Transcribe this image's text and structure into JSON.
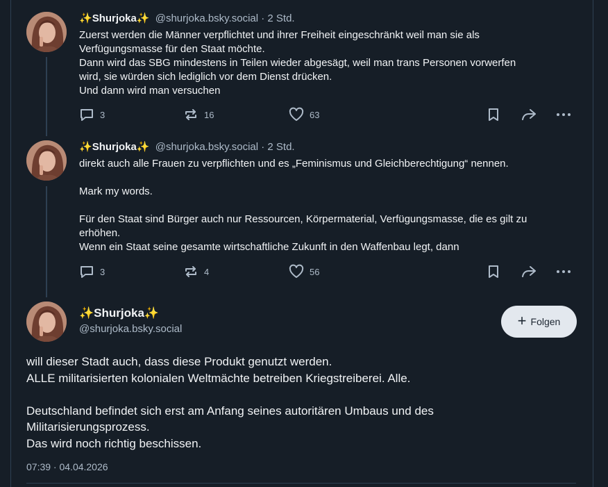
{
  "posts": [
    {
      "author_name": "Shurjoka",
      "sparkle": "✨",
      "handle": "@shurjoka.bsky.social",
      "time": "· 2 Std.",
      "text": "Zuerst werden die Männer verpflichtet und ihrer Freiheit eingeschränkt weil man sie als\nVerfügungsmasse für den Staat möchte.\nDann wird das SBG mindestens in Teilen wieder abgesägt, weil man trans Personen vorwerfen\nwird, sie würden sich lediglich vor dem Dienst drücken.\nUnd dann wird man versuchen",
      "replies": "3",
      "reposts": "16",
      "likes": "63"
    },
    {
      "author_name": "Shurjoka",
      "sparkle": "✨",
      "handle": "@shurjoka.bsky.social",
      "time": "· 2 Std.",
      "text": "direkt auch alle Frauen zu verpflichten und es „Feminismus und Gleichberechtigung“ nennen.\n\nMark my words.\n\nFür den Staat sind Bürger auch nur Ressourcen, Körpermaterial, Verfügungsmasse, die es gilt zu\nerhöhen.\nWenn ein Staat seine gesamte wirtschaftliche Zukunft in den Waffenbau legt, dann",
      "replies": "3",
      "reposts": "4",
      "likes": "56"
    }
  ],
  "main_post": {
    "author_name": "Shurjoka",
    "sparkle": "✨",
    "handle": "@shurjoka.bsky.social",
    "follow_label": "Folgen",
    "text": "will dieser Stadt auch, dass diese Produkt genutzt werden.\nALLE militarisierten kolonialen Weltmächte betreiben Kriegstreiberei. Alle.\n\nDeutschland befindet sich erst am Anfang seines autoritären Umbaus und des\nMilitarisierungsprozess.\nDas wird noch richtig beschissen.",
    "timestamp": "07:39 · 04.04.2026"
  },
  "icons": {
    "reply": "speech-bubble-icon",
    "repost": "repost-arrows-icon",
    "like": "heart-icon",
    "bookmark": "bookmark-icon",
    "share": "share-arrow-icon",
    "more": "more-dots-icon"
  },
  "colors": {
    "background": "#161e27",
    "text": "#f1f3f5",
    "muted": "#aebbc9",
    "border": "#2e4052",
    "follow_bg": "#e3e8ee",
    "sparkle": "#f2b21b"
  }
}
